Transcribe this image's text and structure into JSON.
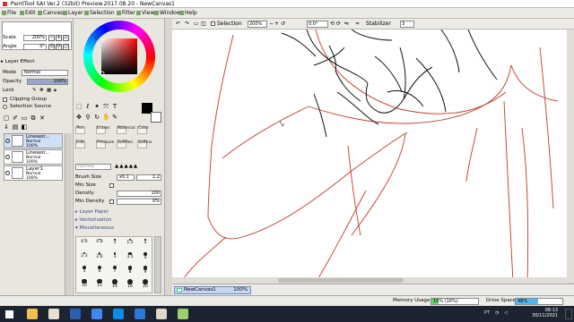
{
  "window": {
    "title": "PaintTool SAI Ver.2 (32bit) Preview.2017.08.20 - NewCanvas1"
  },
  "menu": [
    "File",
    "Edit",
    "Canvas",
    "Layer",
    "Selection",
    "Filter",
    "View",
    "Window",
    "Help"
  ],
  "menu_icon_color": "#7aa06a",
  "toolbar": {
    "selection_label": "Selection",
    "zoom": "200%",
    "angle": "0.0°",
    "stabilizer_label": "Stabilizer",
    "stabilizer_value": "3"
  },
  "navigator": {
    "scale_label": "Scale",
    "scale_value": "200%",
    "angle_label": "Angle",
    "angle_value": "0°"
  },
  "layer_panel": {
    "layer_effect": "Layer Effect",
    "mode_label": "Mode",
    "mode_value": "Normal",
    "opacity_label": "Opacity",
    "opacity_value": "100%",
    "opacity_fraction": 1.0,
    "lock_label": "Lock",
    "clipping_group": "Clipping Group",
    "selection_source": "Selection Source",
    "layers": [
      {
        "name": "Linewor...",
        "mode": "Normal",
        "opacity": "100%"
      },
      {
        "name": "Linewor...",
        "mode": "Normal",
        "opacity": "100%"
      },
      {
        "name": "Layer1",
        "mode": "Normal",
        "opacity": "100%"
      }
    ]
  },
  "tools": {
    "primary_color": "#000000",
    "secondary_color": "#ffffff",
    "brush_tools": [
      {
        "label": "Pen"
      },
      {
        "label": "Eraser"
      },
      {
        "label": "Watercol"
      },
      {
        "label": "Color"
      },
      {
        "label": "Edit"
      },
      {
        "label": "Pressure"
      },
      {
        "label": "SoftPen"
      },
      {
        "label": "Softlns"
      }
    ],
    "mode_value": "Normal",
    "brush_size_label": "Brush Size",
    "brush_size_mult": "x0.1",
    "brush_size_value": "1.2",
    "min_size_label": "Min Size",
    "density_label": "Density",
    "density_value": "100",
    "min_density_label": "Min Density",
    "min_density_value": "0%",
    "layer_paper": "Layer Paper",
    "vectorization": "Vectorization",
    "miscellaneous": "Miscellaneous",
    "size_presets": [
      "0.6",
      "0.8",
      "1",
      "1.5",
      "2",
      "2.3",
      "2.6",
      "3",
      "3.5",
      "4",
      "5",
      "6",
      "7",
      "8",
      "9",
      "10",
      "12",
      "14",
      "16",
      "20"
    ]
  },
  "canvas_tab": {
    "name": "NewCanvas1",
    "zoom": "100%"
  },
  "status": {
    "memory_label": "Memory Usage",
    "memory_value": "15% (16%)",
    "memory_fraction": 0.15,
    "drive_label": "Drive Space",
    "drive_value": "48%",
    "drive_fraction": 0.48,
    "memory_color": "#6ad36a",
    "drive_color": "#4fb8f0"
  },
  "taskbar": {
    "time": "08:13",
    "date": "30/11/2021",
    "lang": "PT",
    "apps": [
      "start-icon",
      "file-explorer-icon",
      "sai-icon",
      "word-icon",
      "chrome-icon",
      "edge-icon",
      "onedrive-icon",
      "sai-app-icon",
      "photos-icon"
    ],
    "app_colors": [
      "#ffffff",
      "#f3c14b",
      "#e8e0d0",
      "#2b5fb3",
      "#4285f4",
      "#0e8be6",
      "#2b79d9",
      "#e0d8c8",
      "#9bd070"
    ]
  }
}
